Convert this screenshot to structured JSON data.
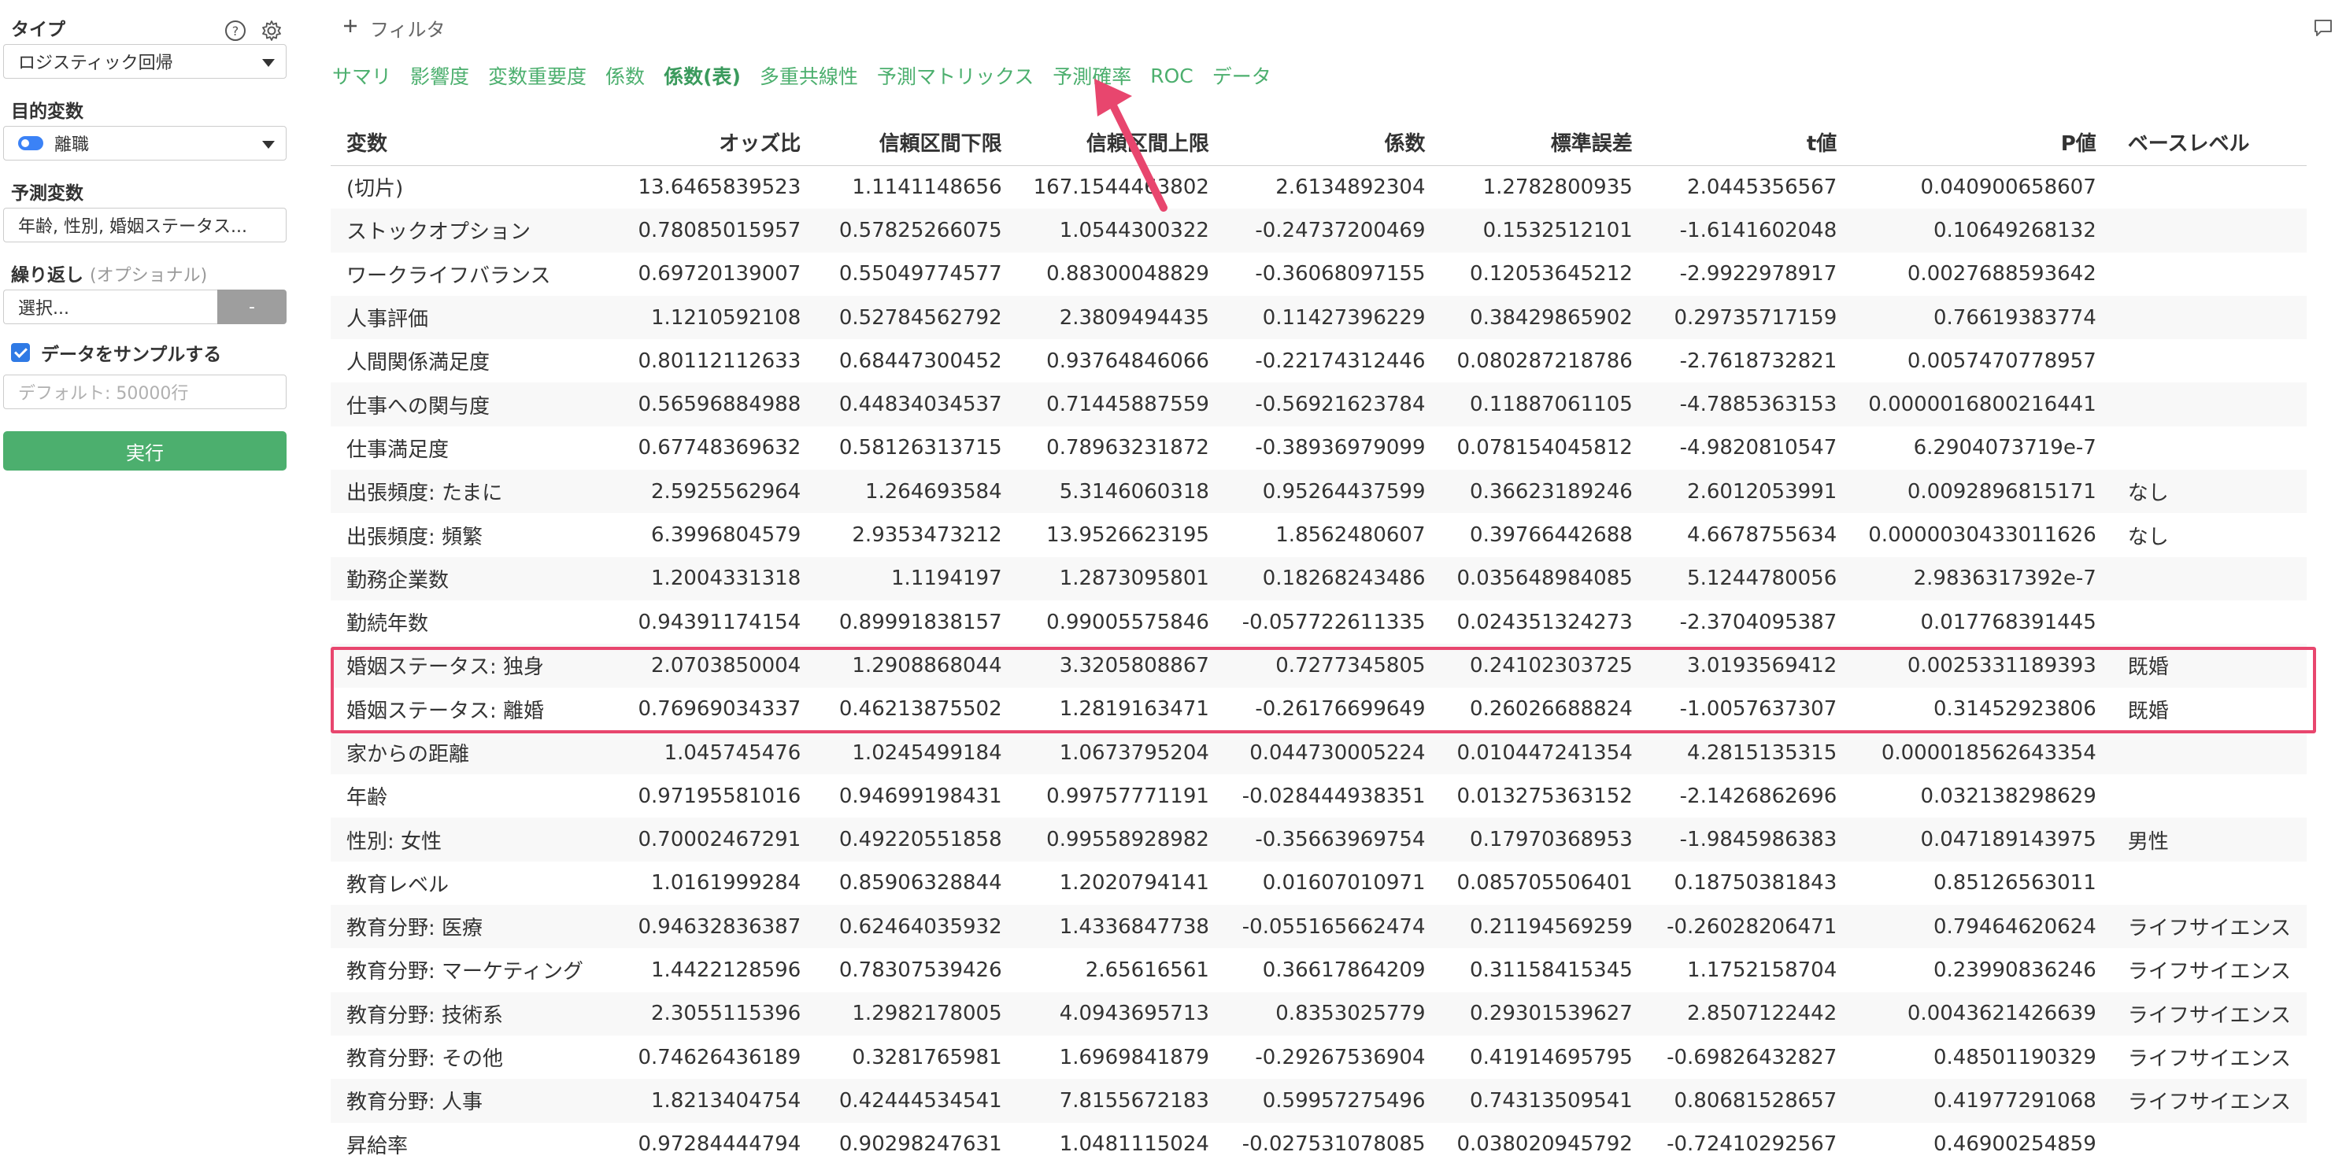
{
  "sidebar": {
    "type_label": "タイプ",
    "type_value": "ロジスティック回帰",
    "target_label": "目的変数",
    "target_value": "離職",
    "predictor_label": "予測変数",
    "predictor_value": "年齢, 性別, 婚姻ステータス...",
    "repeat_label": "繰り返し",
    "repeat_optional": "(オプショナル)",
    "repeat_select": "選択...",
    "repeat_button": "-",
    "sample_label": "データをサンプルする",
    "sample_placeholder": "デフォルト: 50000行",
    "run_button": "実行",
    "help_icon": "question-circle-icon",
    "settings_icon": "gear-icon"
  },
  "main": {
    "filter_label": "フィルタ",
    "tabs": [
      {
        "label": "サマリ"
      },
      {
        "label": "影響度"
      },
      {
        "label": "変数重要度"
      },
      {
        "label": "係数"
      },
      {
        "label": "係数(表)"
      },
      {
        "label": "多重共線性"
      },
      {
        "label": "予測マトリックス"
      },
      {
        "label": "予測確率"
      },
      {
        "label": "ROC"
      },
      {
        "label": "データ"
      }
    ],
    "active_tab": "係数(表)"
  },
  "table": {
    "headers": [
      "変数",
      "オッズ比",
      "信頼区間下限",
      "信頼区間上限",
      "係数",
      "標準誤差",
      "t値",
      "P値",
      "ベースレベル"
    ],
    "rows": [
      [
        "(切片)",
        "13.6465839523",
        "1.1141148656",
        "167.1544463802",
        "2.6134892304",
        "1.2782800935",
        "2.0445356567",
        "0.040900658607",
        ""
      ],
      [
        "ストックオプション",
        "0.78085015957",
        "0.57825266075",
        "1.0544300322",
        "-0.24737200469",
        "0.1532512101",
        "-1.6141602048",
        "0.10649268132",
        ""
      ],
      [
        "ワークライフバランス",
        "0.69720139007",
        "0.55049774577",
        "0.88300048829",
        "-0.36068097155",
        "0.12053645212",
        "-2.9922978917",
        "0.0027688593642",
        ""
      ],
      [
        "人事評価",
        "1.1210592108",
        "0.52784562792",
        "2.3809494435",
        "0.11427396229",
        "0.38429865902",
        "0.29735717159",
        "0.76619383774",
        ""
      ],
      [
        "人間関係満足度",
        "0.80112112633",
        "0.68447300452",
        "0.93764846066",
        "-0.22174312446",
        "0.080287218786",
        "-2.7618732821",
        "0.0057470778957",
        ""
      ],
      [
        "仕事への関与度",
        "0.56596884988",
        "0.44834034537",
        "0.71445887559",
        "-0.56921623784",
        "0.11887061105",
        "-4.7885363153",
        "0.0000016800216441",
        ""
      ],
      [
        "仕事満足度",
        "0.67748369632",
        "0.58126313715",
        "0.78963231872",
        "-0.38936979099",
        "0.078154045812",
        "-4.9820810547",
        "6.2904073719e-7",
        ""
      ],
      [
        "出張頻度: たまに",
        "2.5925562964",
        "1.264693584",
        "5.3146060318",
        "0.95264437599",
        "0.36623189246",
        "2.6012053991",
        "0.0092896815171",
        "なし"
      ],
      [
        "出張頻度: 頻繁",
        "6.3996804579",
        "2.9353473212",
        "13.9526623195",
        "1.8562480607",
        "0.39766442688",
        "4.6678755634",
        "0.0000030433011626",
        "なし"
      ],
      [
        "勤務企業数",
        "1.2004331318",
        "1.1194197",
        "1.2873095801",
        "0.18268243486",
        "0.035648984085",
        "5.1244780056",
        "2.9836317392e-7",
        ""
      ],
      [
        "勤続年数",
        "0.94391174154",
        "0.89991838157",
        "0.99005575846",
        "-0.057722611335",
        "0.024351324273",
        "-2.3704095387",
        "0.017768391445",
        ""
      ],
      [
        "婚姻ステータス: 独身",
        "2.0703850004",
        "1.2908868044",
        "3.3205808867",
        "0.7277345805",
        "0.24102303725",
        "3.0193569412",
        "0.0025331189393",
        "既婚"
      ],
      [
        "婚姻ステータス: 離婚",
        "0.76969034337",
        "0.46213875502",
        "1.2819163471",
        "-0.26176699649",
        "0.26026688824",
        "-1.0057637307",
        "0.31452923806",
        "既婚"
      ],
      [
        "家からの距離",
        "1.045745476",
        "1.0245499184",
        "1.0673795204",
        "0.044730005224",
        "0.010447241354",
        "4.2815135315",
        "0.000018562643354",
        ""
      ],
      [
        "年齢",
        "0.97195581016",
        "0.94699198431",
        "0.99757771191",
        "-0.028444938351",
        "0.013275363152",
        "-2.1426862696",
        "0.032138298629",
        ""
      ],
      [
        "性別: 女性",
        "0.70002467291",
        "0.49220551858",
        "0.99558928982",
        "-0.35663969754",
        "0.17970368953",
        "-1.9845986383",
        "0.047189143975",
        "男性"
      ],
      [
        "教育レベル",
        "1.0161999284",
        "0.85906328844",
        "1.2020794141",
        "0.01607010971",
        "0.085705506401",
        "0.18750381843",
        "0.85126563011",
        ""
      ],
      [
        "教育分野: 医療",
        "0.94632836387",
        "0.62464035932",
        "1.4336847738",
        "-0.055165662474",
        "0.21194569259",
        "-0.26028206471",
        "0.79464620624",
        "ライフサイエンス"
      ],
      [
        "教育分野: マーケティング",
        "1.4422128596",
        "0.78307539426",
        "2.65616561",
        "0.36617864209",
        "0.31158415345",
        "1.1752158704",
        "0.23990836246",
        "ライフサイエンス"
      ],
      [
        "教育分野: 技術系",
        "2.3055115396",
        "1.2982178005",
        "4.0943695713",
        "0.8353025779",
        "0.29301539627",
        "2.8507122442",
        "0.0043621426639",
        "ライフサイエンス"
      ],
      [
        "教育分野: その他",
        "0.74626436189",
        "0.3281765981",
        "1.6969841879",
        "-0.29267536904",
        "0.41914695795",
        "-0.69826432827",
        "0.48501190329",
        "ライフサイエンス"
      ],
      [
        "教育分野: 人事",
        "1.8213404754",
        "0.42444534541",
        "7.8155672183",
        "0.59957275496",
        "0.74313509541",
        "0.80681528657",
        "0.41977291068",
        "ライフサイエンス"
      ],
      [
        "昇給率",
        "0.97284444794",
        "0.90298247631",
        "1.0481115024",
        "-0.027531078085",
        "0.038020945792",
        "-0.72410292567",
        "0.46900254859",
        ""
      ]
    ]
  },
  "colors": {
    "accent": "#4caf6e",
    "highlight": "#e8466e",
    "toggle": "#3b82f6"
  }
}
